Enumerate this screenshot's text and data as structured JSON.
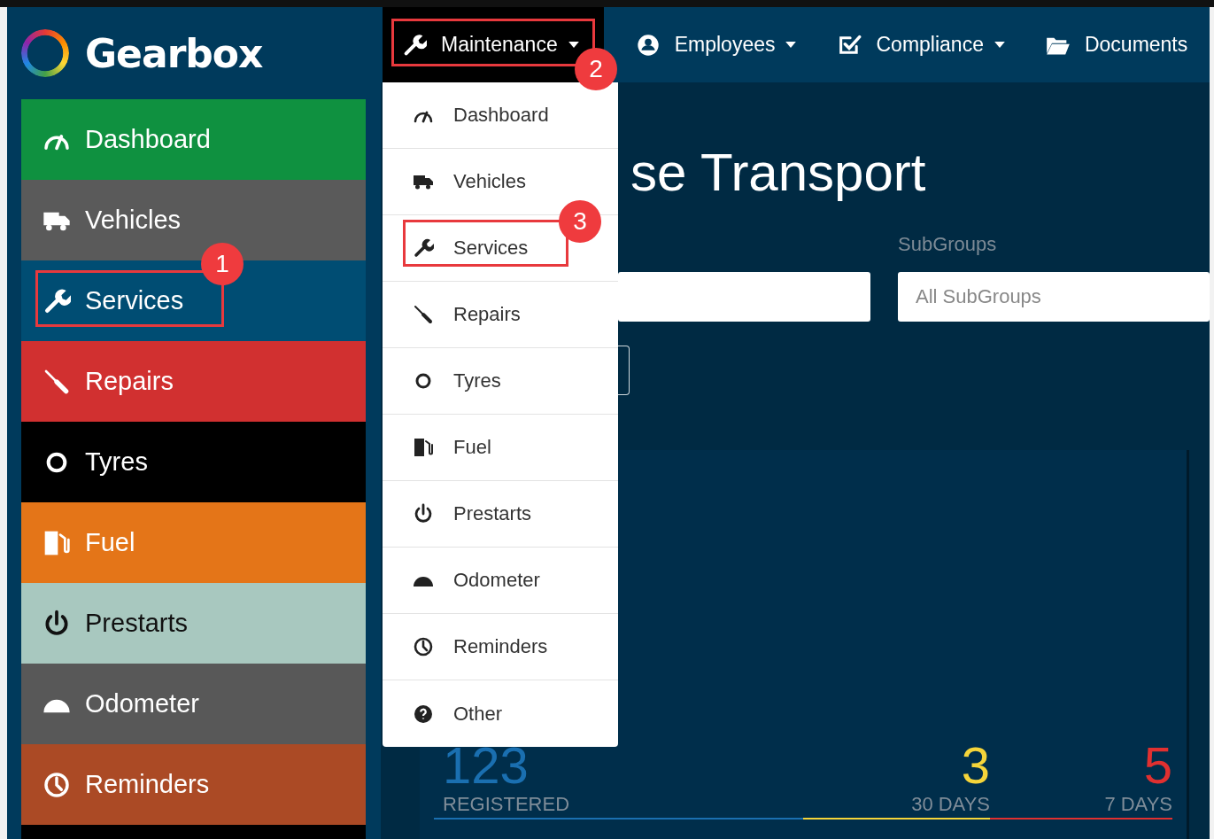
{
  "brand": {
    "name": "Gearbox"
  },
  "sidebar": {
    "items": [
      {
        "label": "Dashboard",
        "color": "#0f9140",
        "dark_text": false
      },
      {
        "label": "Vehicles",
        "color": "#5a5a5a",
        "dark_text": false
      },
      {
        "label": "Services",
        "color": "#004d73",
        "dark_text": false,
        "callout": "1"
      },
      {
        "label": "Repairs",
        "color": "#d13030",
        "dark_text": false
      },
      {
        "label": "Tyres",
        "color": "#000000",
        "dark_text": false
      },
      {
        "label": "Fuel",
        "color": "#e47518",
        "dark_text": false
      },
      {
        "label": "Prestarts",
        "color": "#a8c8bf",
        "dark_text": true
      },
      {
        "label": "Odometer",
        "color": "#585858",
        "dark_text": false
      },
      {
        "label": "Reminders",
        "color": "#ab4a25",
        "dark_text": false
      },
      {
        "color": "#000000"
      }
    ]
  },
  "topnav": {
    "items": [
      {
        "label": "Maintenance",
        "selected": true,
        "caret": true,
        "callout": "2"
      },
      {
        "label": "Employees",
        "selected": false,
        "caret": true
      },
      {
        "label": "Compliance",
        "selected": false,
        "caret": true
      },
      {
        "label": "Documents",
        "selected": false,
        "caret": false
      }
    ]
  },
  "dropdown": {
    "items": [
      {
        "label": "Dashboard"
      },
      {
        "label": "Vehicles"
      },
      {
        "label": "Services",
        "callout": "3"
      },
      {
        "label": "Repairs"
      },
      {
        "label": "Tyres"
      },
      {
        "label": "Fuel"
      },
      {
        "label": "Prestarts"
      },
      {
        "label": "Odometer"
      },
      {
        "label": "Reminders"
      },
      {
        "label": "Other"
      }
    ]
  },
  "main": {
    "title": "se Transport",
    "subgroups": {
      "label": "SubGroups",
      "placeholder": "All SubGroups"
    },
    "stats": [
      {
        "value": "123",
        "label": "REGISTERED",
        "color": "#1a6fb0"
      },
      {
        "value": "3",
        "label": "30 DAYS",
        "color": "#f5d53a"
      },
      {
        "value": "5",
        "label": "7 DAYS",
        "color": "#e03030"
      }
    ]
  }
}
